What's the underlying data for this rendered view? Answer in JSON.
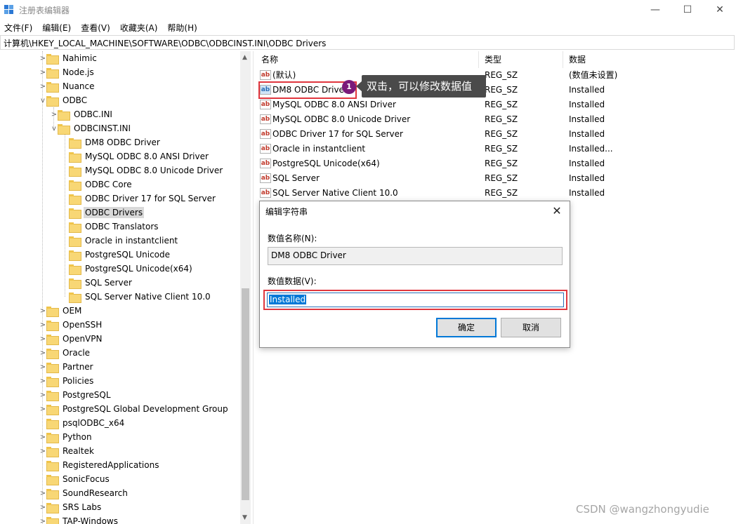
{
  "window": {
    "title": "注册表编辑器",
    "controls": {
      "minimize": "—",
      "maximize": "☐",
      "close": "✕"
    }
  },
  "menu": [
    "文件(F)",
    "编辑(E)",
    "查看(V)",
    "收藏夹(A)",
    "帮助(H)"
  ],
  "address": "计算机\\HKEY_LOCAL_MACHINE\\SOFTWARE\\ODBC\\ODBCINST.INI\\ODBC Drivers",
  "tree": {
    "top_level": [
      {
        "label": "Nahimic",
        "expander": ">"
      },
      {
        "label": "Node.js",
        "expander": ">"
      },
      {
        "label": "Nuance",
        "expander": ">"
      },
      {
        "label": "ODBC",
        "expander": "v"
      }
    ],
    "odbc_children": [
      {
        "label": "ODBC.INI",
        "expander": ">"
      },
      {
        "label": "ODBCINST.INI",
        "expander": "v"
      }
    ],
    "odbcinst_children": [
      "DM8 ODBC Driver",
      "MySQL ODBC 8.0 ANSI Driver",
      "MySQL ODBC 8.0 Unicode Driver",
      "ODBC Core",
      "ODBC Driver 17 for SQL Server",
      "ODBC Drivers",
      "ODBC Translators",
      "Oracle in instantclient",
      "PostgreSQL Unicode",
      "PostgreSQL Unicode(x64)",
      "SQL Server",
      "SQL Server Native Client 10.0"
    ],
    "selected": "ODBC Drivers",
    "after": [
      {
        "label": "OEM",
        "expander": ">"
      },
      {
        "label": "OpenSSH",
        "expander": ">"
      },
      {
        "label": "OpenVPN",
        "expander": ">"
      },
      {
        "label": "Oracle",
        "expander": ">"
      },
      {
        "label": "Partner",
        "expander": ">"
      },
      {
        "label": "Policies",
        "expander": ">"
      },
      {
        "label": "PostgreSQL",
        "expander": ">"
      },
      {
        "label": "PostgreSQL Global Development Group",
        "expander": ">"
      },
      {
        "label": "psqlODBC_x64",
        "expander": ""
      },
      {
        "label": "Python",
        "expander": ">"
      },
      {
        "label": "Realtek",
        "expander": ">"
      },
      {
        "label": "RegisteredApplications",
        "expander": ""
      },
      {
        "label": "SonicFocus",
        "expander": ""
      },
      {
        "label": "SoundResearch",
        "expander": ">"
      },
      {
        "label": "SRS Labs",
        "expander": ">"
      },
      {
        "label": "TAP-Windows",
        "expander": ">"
      }
    ]
  },
  "list": {
    "headers": {
      "name": "名称",
      "type": "类型",
      "data": "数据"
    },
    "rows": [
      {
        "name": "(默认)",
        "type": "REG_SZ",
        "data": "(数值未设置)"
      },
      {
        "name": "DM8 ODBC Driver",
        "type": "REG_SZ",
        "data": "Installed"
      },
      {
        "name": "MySQL ODBC 8.0 ANSI Driver",
        "type": "REG_SZ",
        "data": "Installed"
      },
      {
        "name": "MySQL ODBC 8.0 Unicode Driver",
        "type": "REG_SZ",
        "data": "Installed"
      },
      {
        "name": "ODBC Driver 17 for SQL Server",
        "type": "REG_SZ",
        "data": "Installed"
      },
      {
        "name": "Oracle in instantclient",
        "type": "REG_SZ",
        "data": "Installed..."
      },
      {
        "name": "PostgreSQL Unicode(x64)",
        "type": "REG_SZ",
        "data": "Installed"
      },
      {
        "name": "SQL Server",
        "type": "REG_SZ",
        "data": "Installed"
      },
      {
        "name": "SQL Server Native Client 10.0",
        "type": "REG_SZ",
        "data": "Installed"
      }
    ],
    "icon": "ab"
  },
  "annotation": {
    "badge": "1",
    "callout": "双击，可以修改数据值"
  },
  "dialog": {
    "title": "编辑字符串",
    "name_label": "数值名称(N):",
    "name_value": "DM8 ODBC Driver",
    "data_label": "数值数据(V):",
    "data_value": "Installed",
    "ok": "确定",
    "cancel": "取消"
  },
  "watermark": "CSDN @wangzhongyudie",
  "colors": {
    "folder": "#f8d775",
    "highlight": "#e0363e",
    "badge": "#7a1a7a",
    "selection": "#0078d7"
  }
}
